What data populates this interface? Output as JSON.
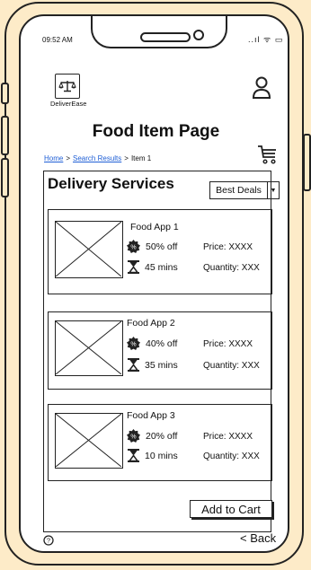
{
  "status_bar": {
    "time": "09:52 AM",
    "icons": "..ıl ᯤ ▭"
  },
  "brand": {
    "name": "DeliverEase"
  },
  "page": {
    "title": "Food Item Page"
  },
  "breadcrumb": {
    "home": "Home",
    "sep": ">",
    "search": "Search Results",
    "current": "Item 1"
  },
  "section": {
    "title": "Delivery Services"
  },
  "sort": {
    "selected": "Best Deals"
  },
  "services": [
    {
      "name": "Food App 1",
      "discount": "50% off",
      "time": "45 mins",
      "price": "Price: XXXX",
      "quantity": "Quantity: XXX"
    },
    {
      "name": "Food App 2",
      "discount": "40% off",
      "time": "35 mins",
      "price": "Price: XXXX",
      "quantity": "Quantity: XXX"
    },
    {
      "name": "Food App 3",
      "discount": "20% off",
      "time": "10 mins",
      "price": "Price: XXXX",
      "quantity": "Quantity: XXX"
    }
  ],
  "actions": {
    "add_to_cart": "Add to Cart",
    "back": "< Back"
  },
  "icons": {
    "logo": "scales-icon",
    "user": "user-icon",
    "cart": "cart-icon",
    "discount": "discount-badge-icon",
    "time": "hourglass-icon",
    "help": "help-icon"
  }
}
